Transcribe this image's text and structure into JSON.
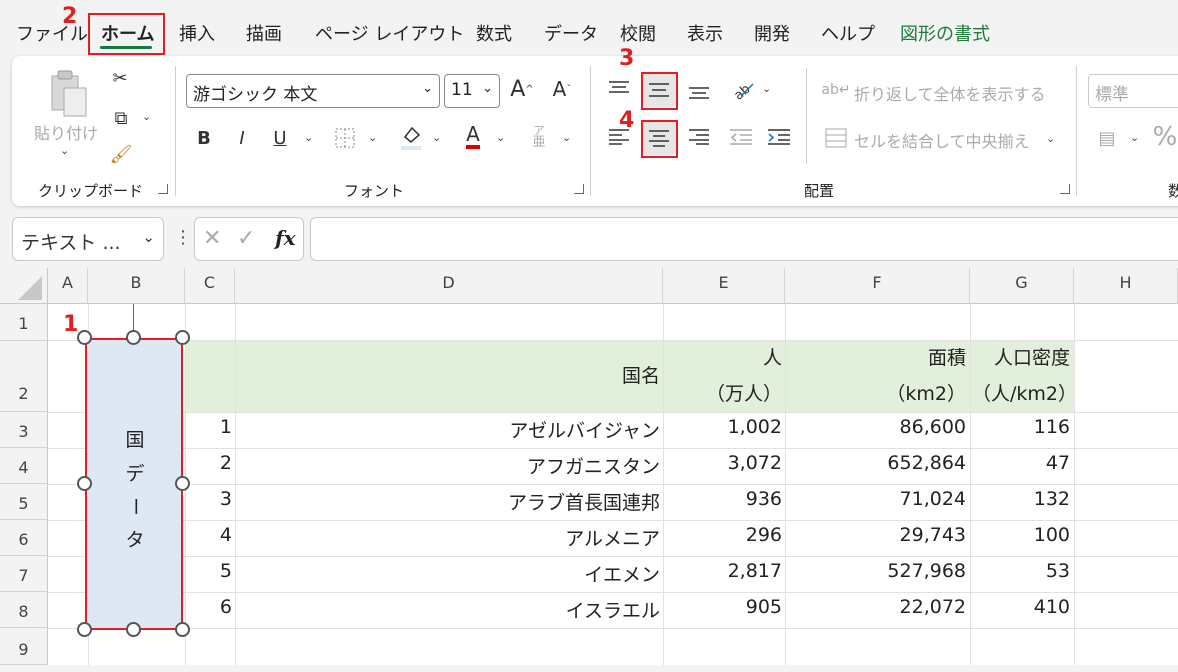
{
  "menu": {
    "tabs": [
      "ファイル",
      "ホーム",
      "挿入",
      "描画",
      "ページ レイアウト",
      "数式",
      "データ",
      "校閲",
      "表示",
      "開発",
      "ヘルプ",
      "図形の書式"
    ]
  },
  "steps": [
    "1",
    "2",
    "3",
    "4"
  ],
  "ribbon": {
    "clipboard": {
      "paste_label": "貼り付け",
      "group_label": "クリップボード"
    },
    "font": {
      "font_name": "游ゴシック 本文",
      "font_size": "11",
      "grow": "A",
      "shrink": "A",
      "bold": "B",
      "italic": "I",
      "underline": "U",
      "font_color": "A",
      "phonetic": "ア",
      "phonetic_sub": "亜",
      "group_label": "フォント"
    },
    "alignment": {
      "wrap_text": "折り返して全体を表示する",
      "merge_center": "セルを結合して中央揃え",
      "group_label": "配置"
    },
    "number": {
      "format": "標準",
      "group_label": "数"
    }
  },
  "formula_bar": {
    "name_box": "テキスト ...",
    "fx": "fx",
    "value": ""
  },
  "sheet": {
    "columns": [
      "A",
      "B",
      "C",
      "D",
      "E",
      "F",
      "G",
      "H"
    ],
    "rows": [
      "1",
      "2",
      "3",
      "4",
      "5",
      "6",
      "7",
      "8",
      "9"
    ],
    "header": {
      "country": "国名",
      "population_l1": "人",
      "population_l2": "（万人）",
      "area_l1": "面積",
      "area_l2": "（km2）",
      "density_l1": "人口密度",
      "density_l2": "（人/km2）"
    },
    "data": [
      {
        "no": "1",
        "name": "アゼルバイジャン",
        "pop": "1,002",
        "area": "86,600",
        "density": "116"
      },
      {
        "no": "2",
        "name": "アフガニスタン",
        "pop": "3,072",
        "area": "652,864",
        "density": "47"
      },
      {
        "no": "3",
        "name": "アラブ首長国連邦",
        "pop": "936",
        "area": "71,024",
        "density": "132"
      },
      {
        "no": "4",
        "name": "アルメニア",
        "pop": "296",
        "area": "29,743",
        "density": "100"
      },
      {
        "no": "5",
        "name": "イエメン",
        "pop": "2,817",
        "area": "527,968",
        "density": "53"
      },
      {
        "no": "6",
        "name": "イスラエル",
        "pop": "905",
        "area": "22,072",
        "density": "410"
      }
    ],
    "shape_text": [
      "国",
      "デ",
      "ー",
      "タ"
    ]
  },
  "colors": {
    "accent": "#107c41",
    "highlight": "#e02020",
    "header_fill": "#e2efda",
    "shape_fill": "#dde8f4"
  }
}
